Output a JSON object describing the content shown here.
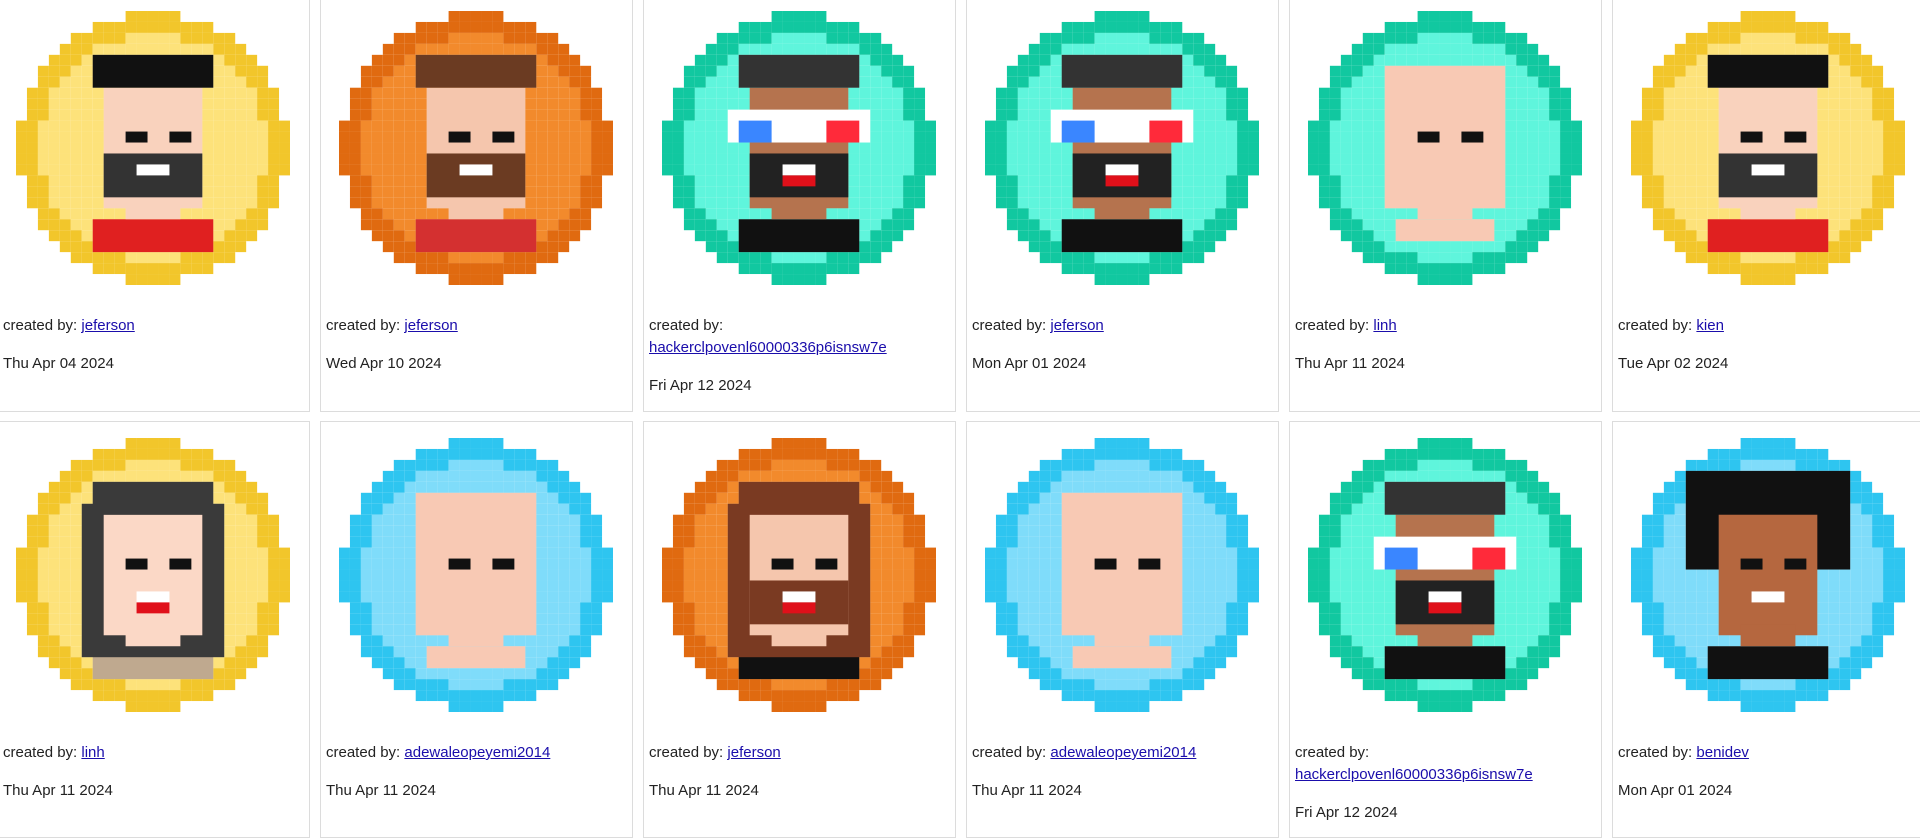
{
  "created_by_prefix": "created by:",
  "cards": [
    {
      "creator": "jeferson",
      "date": "Thu Apr 04 2024",
      "ring": "#f2c62b",
      "inner": "#fde27a",
      "avatar": "man-beard-short-hair-icon"
    },
    {
      "creator": "jeferson",
      "date": "Wed Apr 10 2024",
      "ring": "#e06a10",
      "inner": "#f28a2c",
      "avatar": "man-brown-beard-icon"
    },
    {
      "creator": "hackerclpovenl60000336p6isnsw7e",
      "date": "Fri Apr 12 2024",
      "ring": "#11c8a0",
      "inner": "#5ff5dc",
      "avatar": "man-3d-glasses-icon"
    },
    {
      "creator": "jeferson",
      "date": "Mon Apr 01 2024",
      "ring": "#11c8a0",
      "inner": "#5ff5dc",
      "avatar": "man-3d-glasses-icon"
    },
    {
      "creator": "linh",
      "date": "Thu Apr 11 2024",
      "ring": "#11c8a0",
      "inner": "#5ff5dc",
      "avatar": "bald-head-icon"
    },
    {
      "creator": "kien",
      "date": "Tue Apr 02 2024",
      "ring": "#f2c62b",
      "inner": "#fde27a",
      "avatar": "man-beard-short-hair-icon"
    },
    {
      "creator": "linh",
      "date": "Thu Apr 11 2024",
      "ring": "#f2c62b",
      "inner": "#fde27a",
      "avatar": "woman-long-hair-icon"
    },
    {
      "creator": "adewaleopeyemi2014",
      "date": "Thu Apr 11 2024",
      "ring": "#2ec5f0",
      "inner": "#7fdcfa",
      "avatar": "bald-head-icon"
    },
    {
      "creator": "jeferson",
      "date": "Thu Apr 11 2024",
      "ring": "#e06a10",
      "inner": "#f28a2c",
      "avatar": "long-hair-beard-icon"
    },
    {
      "creator": "adewaleopeyemi2014",
      "date": "Thu Apr 11 2024",
      "ring": "#2ec5f0",
      "inner": "#7fdcfa",
      "avatar": "bald-head-icon"
    },
    {
      "creator": "hackerclpovenl60000336p6isnsw7e",
      "date": "Fri Apr 12 2024",
      "ring": "#11c8a0",
      "inner": "#5ff5dc",
      "avatar": "man-3d-glasses-icon"
    },
    {
      "creator": "benidev",
      "date": "Mon Apr 01 2024",
      "ring": "#2ec5f0",
      "inner": "#7fdcfa",
      "avatar": "man-afro-icon"
    }
  ]
}
